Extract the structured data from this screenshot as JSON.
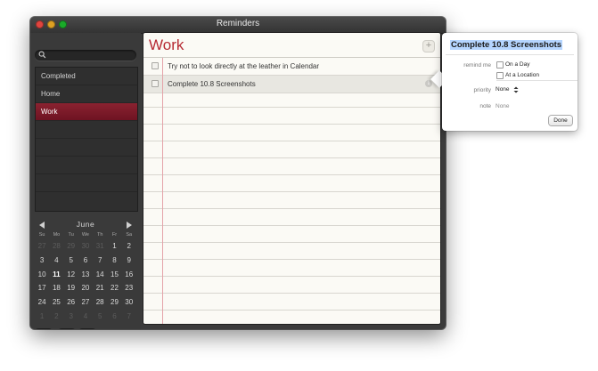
{
  "window": {
    "title": "Reminders"
  },
  "search": {
    "placeholder": ""
  },
  "sidebar": {
    "lists": [
      {
        "label": "Completed"
      },
      {
        "label": "Home"
      },
      {
        "label": "Work",
        "selected": true
      }
    ]
  },
  "calendar": {
    "month": "June",
    "weekdays": [
      "Su",
      "Mo",
      "Tu",
      "We",
      "Th",
      "Fr",
      "Sa"
    ],
    "days": [
      {
        "d": "27",
        "dim": true
      },
      {
        "d": "28",
        "dim": true
      },
      {
        "d": "29",
        "dim": true
      },
      {
        "d": "30",
        "dim": true
      },
      {
        "d": "31",
        "dim": true
      },
      {
        "d": "1"
      },
      {
        "d": "2"
      },
      {
        "d": "3"
      },
      {
        "d": "4"
      },
      {
        "d": "5"
      },
      {
        "d": "6"
      },
      {
        "d": "7"
      },
      {
        "d": "8"
      },
      {
        "d": "9"
      },
      {
        "d": "10"
      },
      {
        "d": "11",
        "today": true
      },
      {
        "d": "12"
      },
      {
        "d": "13"
      },
      {
        "d": "14"
      },
      {
        "d": "15"
      },
      {
        "d": "16"
      },
      {
        "d": "17"
      },
      {
        "d": "18"
      },
      {
        "d": "19"
      },
      {
        "d": "20"
      },
      {
        "d": "21"
      },
      {
        "d": "22"
      },
      {
        "d": "23"
      },
      {
        "d": "24"
      },
      {
        "d": "25"
      },
      {
        "d": "26"
      },
      {
        "d": "27"
      },
      {
        "d": "28"
      },
      {
        "d": "29"
      },
      {
        "d": "30"
      },
      {
        "d": "1",
        "dim": true
      },
      {
        "d": "2",
        "dim": true
      },
      {
        "d": "3",
        "dim": true
      },
      {
        "d": "4",
        "dim": true
      },
      {
        "d": "5",
        "dim": true
      },
      {
        "d": "6",
        "dim": true
      },
      {
        "d": "7",
        "dim": true
      }
    ]
  },
  "main": {
    "list_title": "Work",
    "add_label": "+",
    "reminders": [
      {
        "text": "Try not to look directly at the leather in Calendar",
        "selected": false
      },
      {
        "text": "Complete 10.8 Screenshots",
        "selected": true
      }
    ]
  },
  "popover": {
    "title": "Complete 10.8 Screenshots",
    "remind_label": "remind me",
    "on_day": "On a Day",
    "at_location": "At a Location",
    "priority_label": "priority",
    "priority_value": "None",
    "note_label": "note",
    "note_placeholder": "None",
    "done_label": "Done"
  },
  "colors": {
    "accent_red": "#b62a33",
    "selected_list": "#7b1a28",
    "paper": "#fbfaf5",
    "selection_highlight": "#b5d5ff"
  }
}
